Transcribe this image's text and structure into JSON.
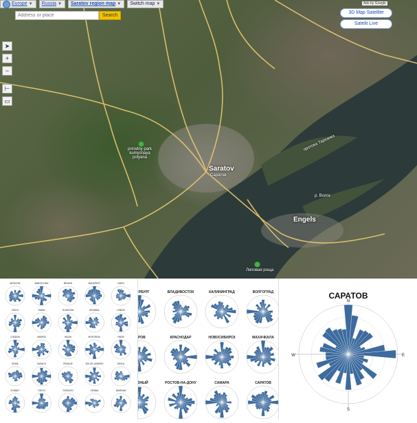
{
  "nav": {
    "crumbs": [
      {
        "label": "Europe",
        "bold": false
      },
      {
        "label": "Russia",
        "bold": false
      },
      {
        "label": "Saratov region map",
        "bold": true
      },
      {
        "label": "Switch map",
        "bold": false
      }
    ]
  },
  "search": {
    "placeholder": "Address or place",
    "button": "Search"
  },
  "ads_label": "Ads by Google",
  "buttons": {
    "map3d": "3D Map Satellite",
    "live": "Satelit Live"
  },
  "map_labels": {
    "city1": "Saratov",
    "city1_sub": "Саратов",
    "city2": "Engels",
    "park": "prirodny park\nkumysnaya\npolyana",
    "river1": "протока Тарханка",
    "river2": "р. Волга",
    "park2": "Липовая роща"
  },
  "panels": {
    "left_cities": [
      [
        "MOSCOW",
        "BARCELONA",
        "BEIJING",
        "BUDAPEST",
        "CAIRO"
      ],
      [
        "DELHI",
        "DUBAI",
        "GLASGOW",
        "ISTANBUL",
        "LISBON"
      ],
      [
        "LONDON",
        "MADRID",
        "MILAN",
        "MONTREAL",
        "PARIS"
      ],
      [
        "ROME",
        "MUNICH",
        "PRAGUE",
        "RIO DE JANEIRO",
        "SEOUL"
      ],
      [
        "SYDNEY",
        "TOKYO",
        "TORONTO",
        "VIENNA",
        "WARSAW"
      ]
    ],
    "mid_cities": [
      [
        "ПЕТЕРБУРГ",
        "ВЛАДИВОСТОК",
        "КАЛИНИНГРАД",
        "ВОЛГОГРАД"
      ],
      [
        "КИРОВ",
        "КРАСНОДАР",
        "НОВОСИБИРСК",
        "МАХАЧКАЛА"
      ],
      [
        "ГРОЗНЫЙ",
        "РОСТОВ-НА-ДОНУ",
        "САМАРА",
        "САРАТОВ"
      ]
    ],
    "right_title": "САРАТОВ",
    "compass": {
      "n": "N",
      "e": "E",
      "s": "S",
      "w": "W"
    }
  },
  "colors": {
    "rose": "#3d6b9e",
    "road": "#e8c872",
    "river": "#2e3e3e"
  }
}
